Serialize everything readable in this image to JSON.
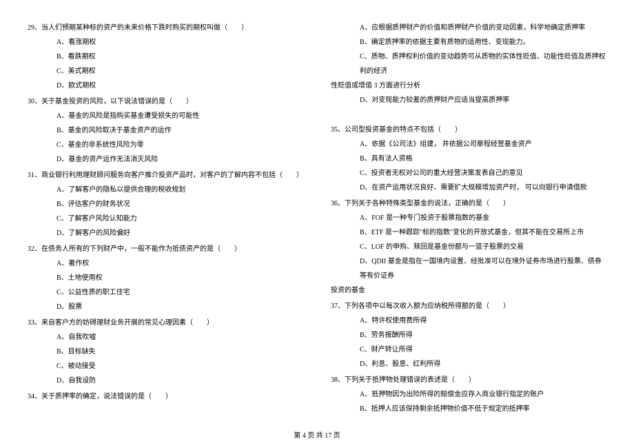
{
  "left": {
    "q29": {
      "text": "29、当人们预期某种标的资产的未来价格下跌时购买的期权叫做（　　）",
      "a": "A、看涨期权",
      "b": "B、看跌期权",
      "c": "C、美式期权",
      "d": "D、欧式期权"
    },
    "q30": {
      "text": "30、关于基金投资的风险，以下说法错误的是（　　）",
      "a": "A、基金的风险是指购买基金遭受损失的可能性",
      "b": "B、基金的风险取决于基金资产的运作",
      "c": "C、基金的非系统性风险为零",
      "d": "D、基金的资产运作无法消灭风险"
    },
    "q31": {
      "text": "31、商业银行利用理财顾问服务向客户推介投资产品时，对客户的了解内容不包括（　　）",
      "a": "A、了解客户的隐私以提供合理的税收规划",
      "b": "B、评估客户的财务状况",
      "c": "C、了解客户风险认知能力",
      "d": "D、了解客户的风险偏好"
    },
    "q32": {
      "text": "32、在债务人所有的下列财产中，一般不能作为抵债资产的是（　　）",
      "a": "A、著作权",
      "b": "B、土地使用权",
      "c": "C、公益性质的职工住宅",
      "d": "D、股票"
    },
    "q33": {
      "text": "33、来自客户方的妨碍理财业务开展的常见心理因素（　　）",
      "a": "A、自我吹嘘",
      "b": "B、目标缺失",
      "c": "C、被动接受",
      "d": "D、自我设防"
    },
    "q34": {
      "text": "34、关于质押率的确定，说法错误的是（　　）"
    }
  },
  "right": {
    "q34cont": {
      "a": "A、应根据质押财产的价值和质押财产价值的变动因素，科学地确定质押率",
      "b": "B、确定质押率的依据主要有质物的适用性、变现能力。",
      "c": "C、质物、质押权利价值的变动趋势可从质物的实体性贬值、功能性贬值及质押权利的经济",
      "c2": "性贬值或增值 3 方面进行分析",
      "d": "D、对变现能力较差的质押财产应适当提高质押率"
    },
    "q35": {
      "text": "35、公司型投资基金的特点不包括（　　）",
      "a": "A、依据《公司法》组建， 并依据公司章程经营基金资产",
      "b": "B、具有法人资格",
      "c": "C、投资者无权对公司的重大经营决策发表自己的意见",
      "d": "D、在资产运用状况良好、需要扩大规模增加资产时， 可以向银行申请借款"
    },
    "q36": {
      "text": "36、下列关于各种特殊类型基金的说法，正确的是（　　）",
      "a": "A、FOF 是一种专门投资于股票指数的基金",
      "b": "B、ETF 是一种跟踪\"标的指数\"变化的开放式基金，但其不能在交易所上市",
      "c": "C、LOF 的申购、赎回是基金份额与一篮子股票的交易",
      "d": "D、QDII 基金是指在一国境内设置、经批准可以在境外证券市场进行股票、债券等有价证券",
      "d2": "投资的基金"
    },
    "q37": {
      "text": "37、下列各项中以每次收入额为应纳税所得额的是（　　）",
      "a": "A、特许权使用费所得",
      "b": "B、劳务报酬所得",
      "c": "C、财产转让所得",
      "d": "D、利息、股息、红利所得"
    },
    "q38": {
      "text": "38、下列关于抵押物处理错误的表述是（　　）",
      "a": "A、抵押物因为出险所得的赔偿金应存入商业银行指定的账户",
      "b": "B、抵押人应该保持剩余抵押物价值不低于规定的抵押率"
    }
  },
  "footer": "第 4 页 共 17 页"
}
